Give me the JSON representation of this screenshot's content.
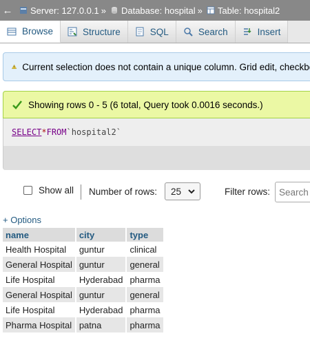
{
  "breadcrumb": {
    "server": "Server: 127.0.0.1",
    "database": "Database: hospital",
    "table": "Table: hospital2",
    "sep": "»"
  },
  "tabs": [
    {
      "label": "Browse",
      "icon": "browse-icon"
    },
    {
      "label": "Structure",
      "icon": "structure-icon"
    },
    {
      "label": "SQL",
      "icon": "sql-icon"
    },
    {
      "label": "Search",
      "icon": "search-icon"
    },
    {
      "label": "Insert",
      "icon": "insert-icon"
    }
  ],
  "warning": {
    "text": "Current selection does not contain a unique column. Grid edit, checkbox"
  },
  "success": {
    "text": "Showing rows 0 - 5 (6 total, Query took 0.0016 seconds.)"
  },
  "query": {
    "select": "SELECT",
    "star": "*",
    "from": "FROM",
    "table": "`hospital2`"
  },
  "nav": {
    "show_all": "Show all",
    "num_rows_label": "Number of rows:",
    "num_rows_value": "25",
    "filter_label": "Filter rows:",
    "search_placeholder": "Search"
  },
  "options_link": "+ Options",
  "table": {
    "columns": [
      "name",
      "city",
      "type"
    ],
    "rows": [
      [
        "Health Hospital",
        "guntur",
        "clinical"
      ],
      [
        "General Hospital",
        "guntur",
        "general"
      ],
      [
        "Life Hospital",
        "Hyderabad",
        "pharma"
      ],
      [
        "General Hospital",
        "guntur",
        "general"
      ],
      [
        "Life Hospital",
        "Hyderabad",
        "pharma"
      ],
      [
        "Pharma Hospital",
        "patna",
        "pharma"
      ]
    ]
  },
  "colors": {
    "topbar": "#888888",
    "link": "#235a81",
    "success_bg": "#ebf8a4",
    "warning_bg": "#e3f0fb"
  }
}
